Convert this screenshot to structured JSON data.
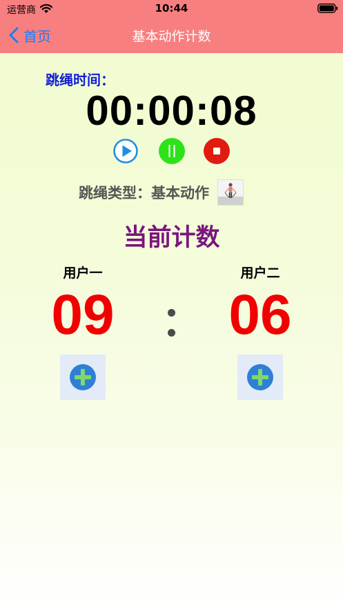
{
  "status_bar": {
    "carrier": "运营商",
    "time": "10:44"
  },
  "nav": {
    "back_label": "首页",
    "title": "基本动作计数"
  },
  "timer": {
    "label": "跳绳时间：",
    "value": "00:00:08"
  },
  "controls": {
    "play_color": "#1e8fe0",
    "pause_color": "#2ee21b",
    "stop_color": "#e01c10"
  },
  "jump_type": {
    "text": "跳绳类型：基本动作"
  },
  "count": {
    "title": "当前计数",
    "users": [
      {
        "name": "用户一",
        "score": "09"
      },
      {
        "name": "用户二",
        "score": "06"
      }
    ]
  },
  "colors": {
    "nav_bar": "#f77f7f",
    "back_accent": "#1e7cf5",
    "timer_label": "#0f1fd6",
    "count_title": "#7a157e",
    "score": "#f20000",
    "add_button_circle": "#2f7fd6",
    "add_button_plus": "#7fd86a"
  }
}
